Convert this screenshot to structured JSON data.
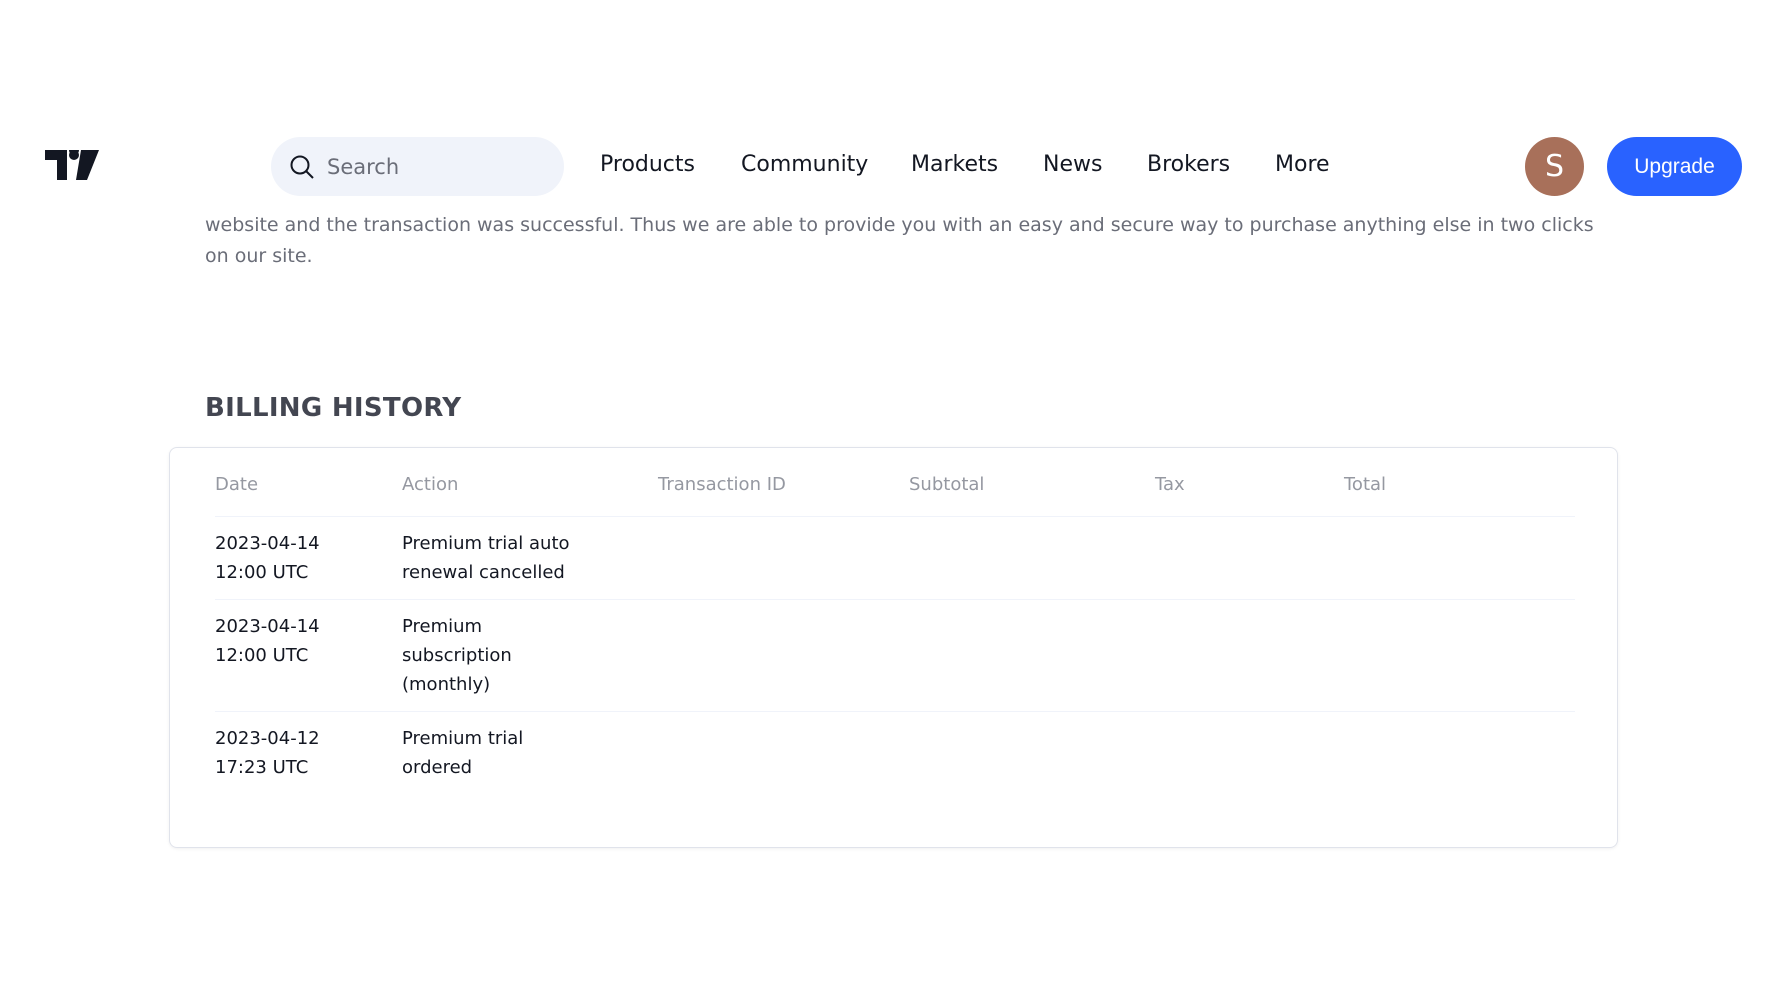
{
  "header": {
    "search_placeholder": "Search",
    "nav": [
      "Products",
      "Community",
      "Markets",
      "News",
      "Brokers",
      "More"
    ],
    "avatar_letter": "S",
    "upgrade": "Upgrade"
  },
  "intro": "website and the transaction was successful. Thus we are able to provide you with an easy and secure way to purchase anything else in two clicks on our site.",
  "billing": {
    "title": "BILLING HISTORY",
    "columns": [
      "Date",
      "Action",
      "Transaction ID",
      "Subtotal",
      "Tax",
      "Total"
    ],
    "rows": [
      {
        "date": "2023-04-14 12:00 UTC",
        "action": "Premium trial auto renewal cancelled"
      },
      {
        "date": "2023-04-14 12:00 UTC",
        "action": "Premium subscription (monthly)"
      },
      {
        "date": "2023-04-12 17:23 UTC",
        "action": "Premium trial ordered"
      }
    ]
  }
}
